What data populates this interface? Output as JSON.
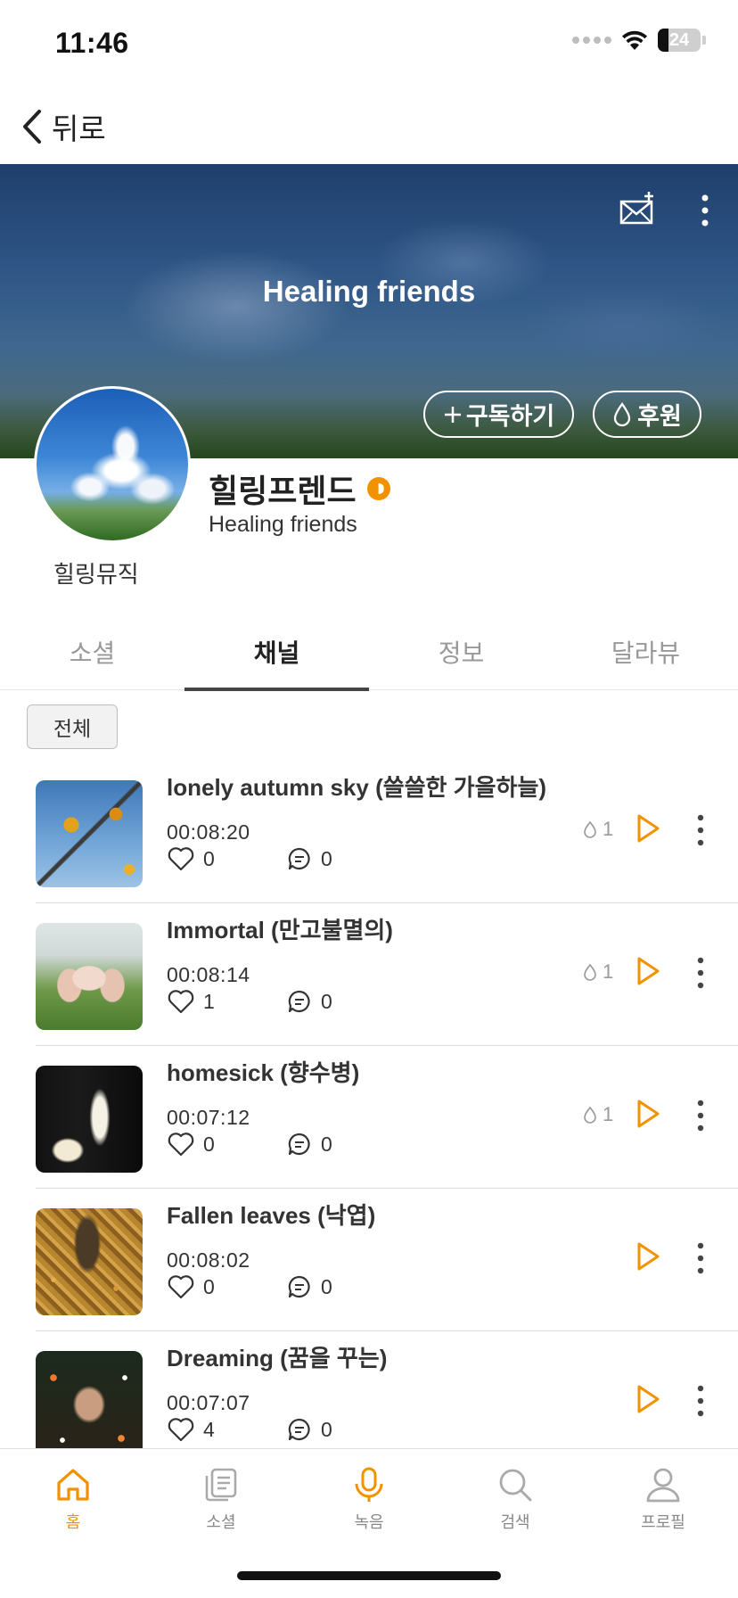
{
  "status_bar": {
    "time": "11:46",
    "battery": "24",
    "battery_level": 0.24
  },
  "nav": {
    "back_label": "뒤로"
  },
  "banner": {
    "title": "Healing friends",
    "subscribe_label": "구독하기",
    "donate_label": "후원"
  },
  "profile": {
    "name": "힐링프렌드",
    "subtitle": "Healing friends",
    "category": "힐링뮤직"
  },
  "tabs": [
    {
      "label": "소셜",
      "active": false
    },
    {
      "label": "채널",
      "active": true
    },
    {
      "label": "정보",
      "active": false
    },
    {
      "label": "달라뷰",
      "active": false
    }
  ],
  "filter": {
    "label": "전체"
  },
  "tracks": [
    {
      "title": "lonely autumn sky (쓸쓸한 가을하늘)",
      "duration": "00:08:20",
      "likes": "0",
      "comments": "0",
      "drops": "1"
    },
    {
      "title": "Immortal (만고불멸의)",
      "duration": "00:08:14",
      "likes": "1",
      "comments": "0",
      "drops": "1"
    },
    {
      "title": "homesick (향수병)",
      "duration": "00:07:12",
      "likes": "0",
      "comments": "0",
      "drops": "1"
    },
    {
      "title": "Fallen leaves (낙엽)",
      "duration": "00:08:02",
      "likes": "0",
      "comments": "0",
      "drops": ""
    },
    {
      "title": "Dreaming (꿈을 꾸는)",
      "duration": "00:07:07",
      "likes": "4",
      "comments": "0",
      "drops": ""
    }
  ],
  "bottom_nav": [
    {
      "label": "홈",
      "icon": "home-icon",
      "active": true
    },
    {
      "label": "소셜",
      "icon": "social-icon",
      "active": false
    },
    {
      "label": "녹음",
      "icon": "mic-icon",
      "active": false
    },
    {
      "label": "검색",
      "icon": "search-icon",
      "active": false
    },
    {
      "label": "프로필",
      "icon": "profile-icon",
      "active": false
    }
  ],
  "colors": {
    "accent": "#f39200",
    "text": "#222222",
    "muted": "#999999"
  }
}
